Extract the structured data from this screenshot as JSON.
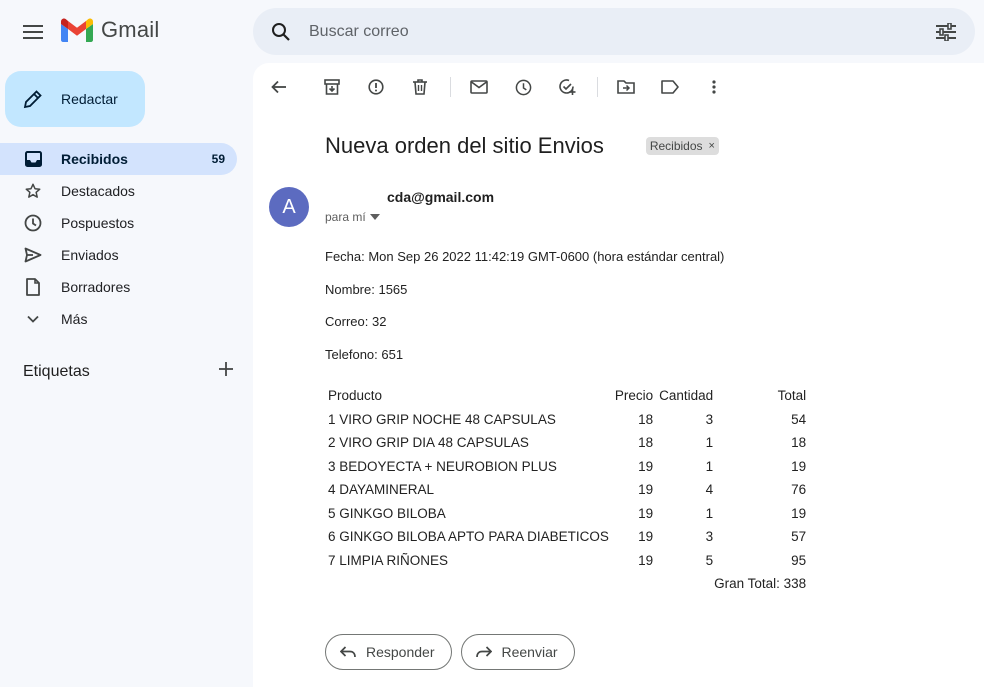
{
  "app": {
    "logo_text": "Gmail"
  },
  "search": {
    "placeholder": "Buscar correo"
  },
  "compose": {
    "label": "Redactar"
  },
  "nav": {
    "items": [
      {
        "label": "Recibidos",
        "count": "59",
        "icon": "inbox-icon"
      },
      {
        "label": "Destacados",
        "icon": "star-icon"
      },
      {
        "label": "Pospuestos",
        "icon": "clock-icon"
      },
      {
        "label": "Enviados",
        "icon": "send-icon"
      },
      {
        "label": "Borradores",
        "icon": "draft-icon"
      },
      {
        "label": "Más",
        "icon": "chevron-down-icon"
      }
    ]
  },
  "labels": {
    "title": "Etiquetas"
  },
  "email": {
    "subject": "Nueva orden del sitio Envios",
    "label_chip": "Recibidos",
    "chip_close": "×",
    "avatar_letter": "A",
    "sender": "cda@gmail.com",
    "to": "para mí",
    "lines": {
      "fecha": "Fecha: Mon Sep 26 2022 11:42:19 GMT-0600 (hora estándar central)",
      "nombre": "Nombre: 1565",
      "correo": "Correo: 32",
      "telefono": "Telefono: 651"
    },
    "table": {
      "headers": {
        "producto": "Producto",
        "precio": "Precio",
        "cantidad": "Cantidad",
        "total": "Total"
      },
      "rows": [
        {
          "producto": "1 VIRO GRIP NOCHE 48 CAPSULAS",
          "precio": "18",
          "cantidad": "3",
          "total": "54"
        },
        {
          "producto": "2 VIRO GRIP DIA 48 CAPSULAS",
          "precio": "18",
          "cantidad": "1",
          "total": "18"
        },
        {
          "producto": "3 BEDOYECTA + NEUROBION PLUS",
          "precio": "19",
          "cantidad": "1",
          "total": "19"
        },
        {
          "producto": "4 DAYAMINERAL",
          "precio": "19",
          "cantidad": "4",
          "total": "76"
        },
        {
          "producto": "5 GINKGO BILOBA",
          "precio": "19",
          "cantidad": "1",
          "total": "19"
        },
        {
          "producto": "6 GINKGO BILOBA APTO PARA DIABETICOS",
          "precio": "19",
          "cantidad": "3",
          "total": "57"
        },
        {
          "producto": "7 LIMPIA RIÑONES",
          "precio": "19",
          "cantidad": "5",
          "total": "95"
        }
      ],
      "grand_total": "Gran Total: 338"
    }
  },
  "actions": {
    "reply": "Responder",
    "forward": "Reenviar"
  },
  "colors": {
    "active_nav": "#d3e3fd",
    "compose": "#c2e7ff",
    "avatar": "#5c6bc0",
    "search_bg": "#e9eef6"
  }
}
